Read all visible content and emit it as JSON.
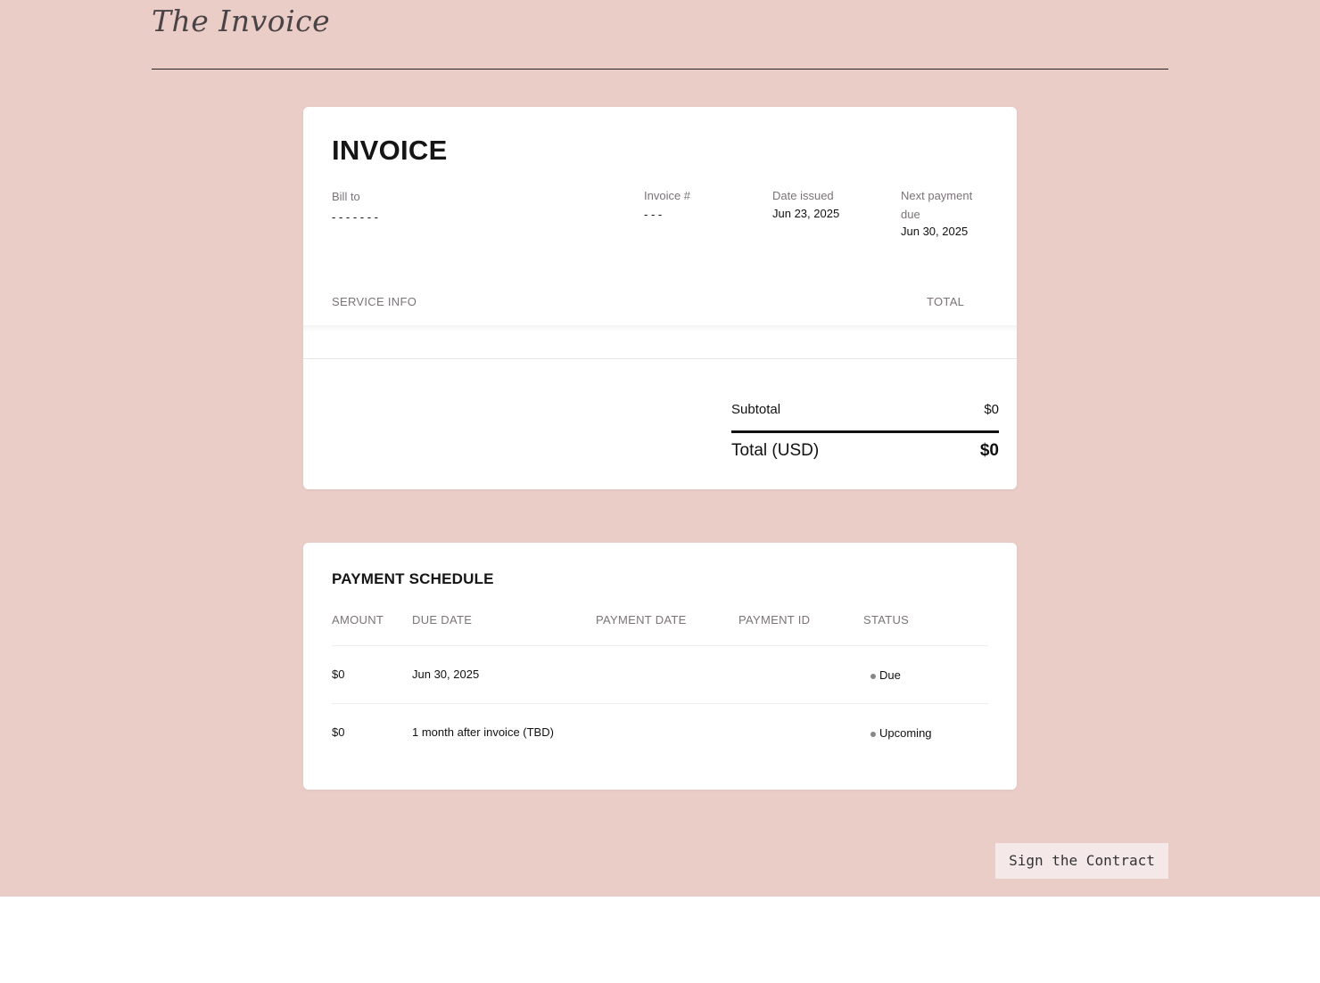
{
  "brand": {
    "title": "The Invoice"
  },
  "invoice": {
    "title": "INVOICE",
    "bill_to": {
      "label": "Bill to",
      "value": "- - - - - - -"
    },
    "invoice_number": {
      "label": "Invoice #",
      "value": "- - -"
    },
    "date_issued": {
      "label": "Date issued",
      "value": "Jun 23, 2025"
    },
    "next_payment": {
      "label": "Next payment due",
      "value": "Jun 30, 2025"
    },
    "columns": {
      "service": "SERVICE INFO",
      "total": "TOTAL"
    },
    "subtotal": {
      "label": "Subtotal",
      "value": "$0"
    },
    "total": {
      "label": "Total (USD)",
      "value": "$0"
    }
  },
  "schedule": {
    "title": "PAYMENT SCHEDULE",
    "columns": [
      "AMOUNT",
      "DUE DATE",
      "PAYMENT DATE",
      "PAYMENT ID",
      "STATUS"
    ],
    "rows": [
      {
        "amount": "$0",
        "due_date": "Jun 30, 2025",
        "payment_date": "",
        "payment_id": "",
        "status": "Due"
      },
      {
        "amount": "$0",
        "due_date": "1 month after invoice (TBD)",
        "payment_date": "",
        "payment_id": "",
        "status": "Upcoming"
      }
    ]
  },
  "actions": {
    "sign_label": "Sign the Contract"
  },
  "colors": {
    "background": "#ebcdc8",
    "card": "#ffffff",
    "button": "#f4e9e8",
    "status_dot": "#888888"
  }
}
